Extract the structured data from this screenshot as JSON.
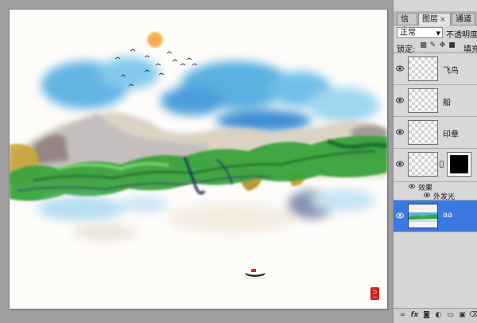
{
  "panel": {
    "tabs": [
      {
        "label": "信息"
      },
      {
        "label": "图层",
        "close": "×"
      },
      {
        "label": "通道"
      }
    ],
    "blend_mode": "正常",
    "opacity_label": "不透明度:",
    "lock_label": "锁定:",
    "fill_label": "填充:",
    "layers": [
      {
        "name": "飞鸟",
        "visible": true,
        "selected": false
      },
      {
        "name": "船",
        "visible": true,
        "selected": false
      },
      {
        "name": "印章",
        "visible": true,
        "selected": false
      },
      {
        "name": "",
        "visible": true,
        "selected": false,
        "has_mask": true
      },
      {
        "name": "aa",
        "visible": true,
        "selected": true
      }
    ],
    "effects_label": "效果",
    "effect_outer_glow": "外发光",
    "bottom_icons": [
      "link-icon",
      "fx-icon",
      "mask-icon",
      "adjustment-icon",
      "folder-icon",
      "new-layer-icon",
      "trash-icon"
    ]
  },
  "colors": {
    "selected_layer": "#3b78e0",
    "panel_bg": "#d6d6d6",
    "workspace": "#9e9e9e"
  }
}
